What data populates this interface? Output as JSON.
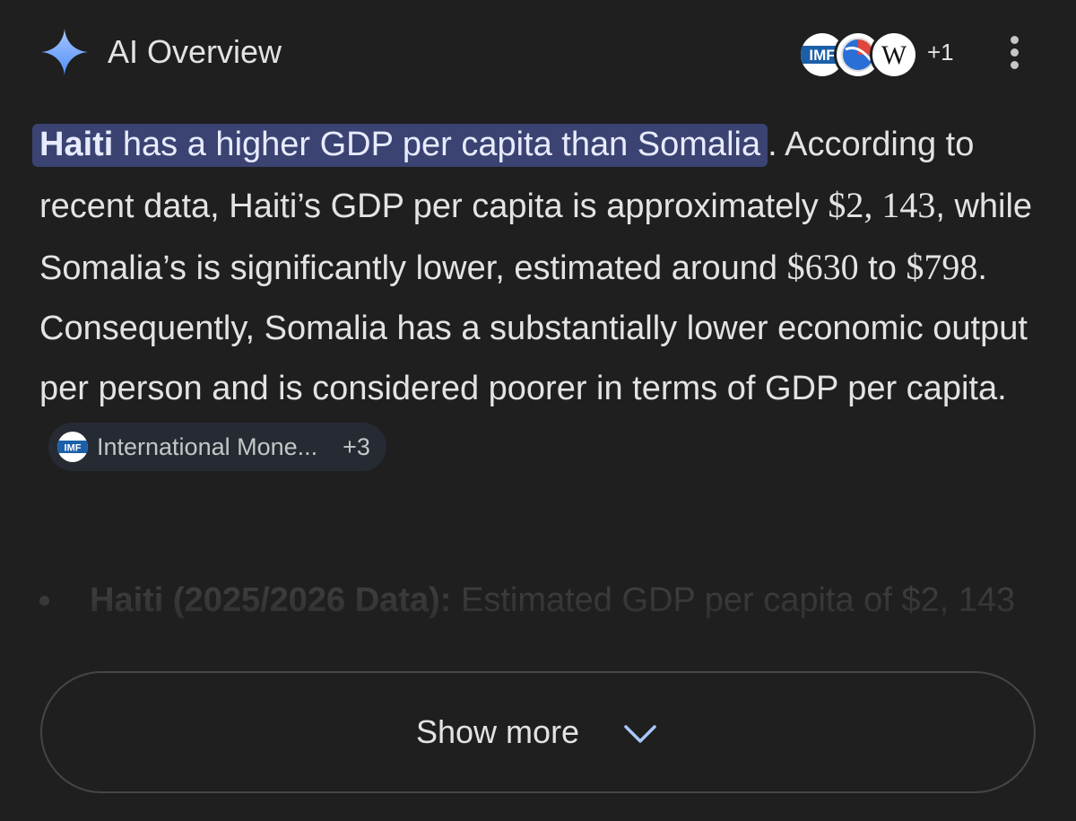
{
  "header": {
    "title": "AI Overview",
    "sources_icons": [
      "imf-logo-icon",
      "globe-logo-icon",
      "wikipedia-logo-icon"
    ],
    "more_sources": "+1",
    "menu_icon": "more-vert-icon"
  },
  "answer": {
    "headline_bold": "Haiti",
    "headline_rest": " has a higher GDP per capita than Somalia",
    "headline_end": ".",
    "text_1": " According to recent data, Haiti’s GDP per capita is approximately ",
    "value_haiti": "$2, 143",
    "text_2": ", while Somalia’s is significantly lower, estimated around ",
    "value_somalia_low": "$630",
    "text_3": " to ",
    "value_somalia_high": "$798",
    "text_4": ". Consequently, Somalia has a substantially lower economic output per person and is considered poorer in terms of GDP per capita.",
    "source_chip": {
      "icon": "imf-logo-icon",
      "label": "International Mone...",
      "count": "+3"
    }
  },
  "bullets": [
    {
      "label": "Haiti (2025/2026 Data):",
      "text": " Estimated GDP per capita of $2, 143"
    }
  ],
  "show_more": {
    "label": "Show more",
    "icon": "chevron-down-icon"
  },
  "colors": {
    "background": "#1f1f1f",
    "text": "#e3e3e3",
    "highlight": "#3a4371",
    "sparkle_top": "#8ab4f8",
    "sparkle_bottom": "#4285f4",
    "chip_bg": "#262a33",
    "button_border": "#444746"
  }
}
